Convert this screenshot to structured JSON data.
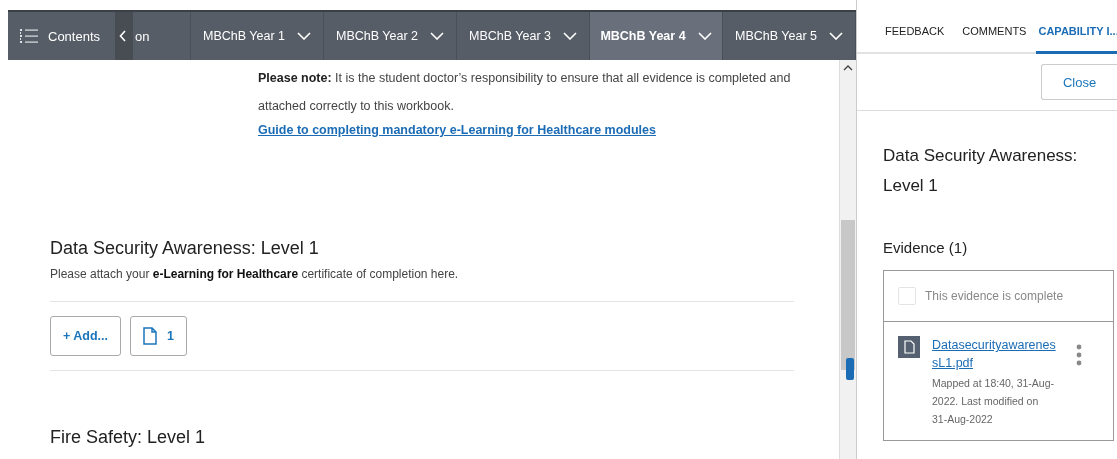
{
  "nav": {
    "contents_label": "Contents",
    "back_fragment": "on",
    "tabs": [
      {
        "label": "MBChB Year 1",
        "selected": false
      },
      {
        "label": "MBChB Year 2",
        "selected": false
      },
      {
        "label": "MBChB Year 3",
        "selected": false
      },
      {
        "label": "MBChB Year 4",
        "selected": true
      },
      {
        "label": "MBChB Year 5",
        "selected": false
      }
    ]
  },
  "content": {
    "note": "**Please note:** It is the student doctor’s responsibility to ensure that all evidence is completed and attached correctly to this workbook.",
    "guide_link": "Guide to completing mandatory e-Learning for Healthcare modules",
    "sections": [
      {
        "title": "Data Security Awareness: Level 1",
        "description": "Please attach your **e-Learning for Healthcare** certificate of completion here.",
        "add_label": "+ Add...",
        "file_count": "1"
      },
      {
        "title": "Fire Safety: Level 1"
      }
    ]
  },
  "panel": {
    "tabs": [
      {
        "label": "FEEDBACK",
        "selected": false
      },
      {
        "label": "COMMENTS",
        "selected": false
      },
      {
        "label": "CAPABILITY I...",
        "selected": true
      }
    ],
    "close_label": "Close",
    "title": "Data Security Awareness: Level 1",
    "evidence_heading": "Evidence (1)",
    "complete": {
      "label": "This evidence is complete",
      "checked": false
    },
    "files": [
      {
        "name": "DatasecurityawarenessL1.pdf",
        "meta": "Mapped at 18:40, 31-Aug-2022. Last modified on 31-Aug-2022"
      }
    ]
  }
}
